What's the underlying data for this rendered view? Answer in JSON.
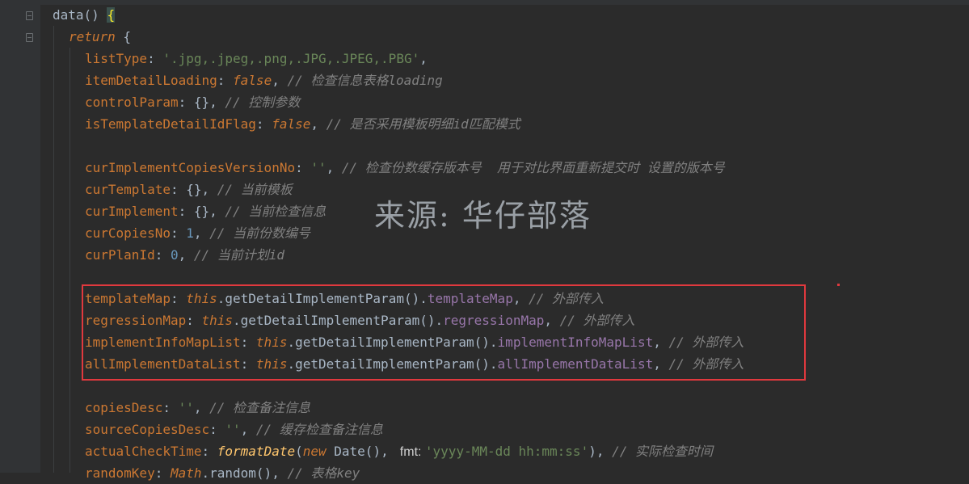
{
  "code_lines": [
    {
      "tokens": [
        {
          "t": "data",
          "c": "method"
        },
        {
          "t": "() ",
          "c": "punc"
        },
        {
          "t": "{",
          "c": "brace-hl"
        }
      ]
    },
    {
      "tokens": [
        {
          "t": "return",
          "c": "kwi"
        },
        {
          "t": " {",
          "c": "punc"
        }
      ]
    },
    {
      "tokens": [
        {
          "t": "listType",
          "c": "prop"
        },
        {
          "t": ": ",
          "c": "punc"
        },
        {
          "t": "'.jpg,.jpeg,.png,.JPG,.JPEG,.PBG'",
          "c": "str"
        },
        {
          "t": ",",
          "c": "punc"
        }
      ]
    },
    {
      "tokens": [
        {
          "t": "itemDetailLoading",
          "c": "prop"
        },
        {
          "t": ": ",
          "c": "punc"
        },
        {
          "t": "false",
          "c": "kwi"
        },
        {
          "t": ", ",
          "c": "punc"
        },
        {
          "t": "// 检查信息表格loading",
          "c": "cmt"
        }
      ]
    },
    {
      "tokens": [
        {
          "t": "controlParam",
          "c": "prop"
        },
        {
          "t": ": {}, ",
          "c": "punc"
        },
        {
          "t": "// 控制参数",
          "c": "cmt"
        }
      ]
    },
    {
      "tokens": [
        {
          "t": "isTemplateDetailIdFlag",
          "c": "prop"
        },
        {
          "t": ": ",
          "c": "punc"
        },
        {
          "t": "false",
          "c": "kwi"
        },
        {
          "t": ", ",
          "c": "punc"
        },
        {
          "t": "// 是否采用模板明细id匹配模式",
          "c": "cmt"
        }
      ]
    },
    {
      "tokens": []
    },
    {
      "tokens": [
        {
          "t": "curImplementCopiesVersionNo",
          "c": "prop"
        },
        {
          "t": ": ",
          "c": "punc"
        },
        {
          "t": "''",
          "c": "str"
        },
        {
          "t": ", ",
          "c": "punc"
        },
        {
          "t": "// 检查份数缓存版本号  用于对比界面重新提交时 设置的版本号",
          "c": "cmt"
        }
      ]
    },
    {
      "tokens": [
        {
          "t": "curTemplate",
          "c": "prop"
        },
        {
          "t": ": {}, ",
          "c": "punc"
        },
        {
          "t": "// 当前模板",
          "c": "cmt"
        }
      ]
    },
    {
      "tokens": [
        {
          "t": "curImplement",
          "c": "prop"
        },
        {
          "t": ": {}, ",
          "c": "punc"
        },
        {
          "t": "// 当前检查信息",
          "c": "cmt"
        }
      ]
    },
    {
      "tokens": [
        {
          "t": "curCopiesNo",
          "c": "prop"
        },
        {
          "t": ": ",
          "c": "punc"
        },
        {
          "t": "1",
          "c": "num"
        },
        {
          "t": ", ",
          "c": "punc"
        },
        {
          "t": "// 当前份数编号",
          "c": "cmt"
        }
      ]
    },
    {
      "tokens": [
        {
          "t": "curPlanId",
          "c": "prop"
        },
        {
          "t": ": ",
          "c": "punc"
        },
        {
          "t": "0",
          "c": "num"
        },
        {
          "t": ", ",
          "c": "punc"
        },
        {
          "t": "// 当前计划id",
          "c": "cmt"
        }
      ]
    },
    {
      "tokens": []
    },
    {
      "tokens": [
        {
          "t": "templateMap",
          "c": "prop"
        },
        {
          "t": ": ",
          "c": "punc"
        },
        {
          "t": "this",
          "c": "this"
        },
        {
          "t": ".getDetailImplementParam().",
          "c": "method"
        },
        {
          "t": "templateMap",
          "c": "field"
        },
        {
          "t": ", ",
          "c": "punc"
        },
        {
          "t": "// 外部传入",
          "c": "cmt"
        }
      ]
    },
    {
      "tokens": [
        {
          "t": "regressionMap",
          "c": "prop"
        },
        {
          "t": ": ",
          "c": "punc"
        },
        {
          "t": "this",
          "c": "this"
        },
        {
          "t": ".getDetailImplementParam().",
          "c": "method"
        },
        {
          "t": "regressionMap",
          "c": "field"
        },
        {
          "t": ", ",
          "c": "punc"
        },
        {
          "t": "// 外部传入",
          "c": "cmt"
        }
      ]
    },
    {
      "tokens": [
        {
          "t": "implementInfoMapList",
          "c": "prop"
        },
        {
          "t": ": ",
          "c": "punc"
        },
        {
          "t": "this",
          "c": "this"
        },
        {
          "t": ".getDetailImplementParam().",
          "c": "method"
        },
        {
          "t": "implementInfoMapList",
          "c": "field"
        },
        {
          "t": ", ",
          "c": "punc"
        },
        {
          "t": "// 外部传入",
          "c": "cmt"
        }
      ]
    },
    {
      "tokens": [
        {
          "t": "allImplementDataList",
          "c": "prop"
        },
        {
          "t": ": ",
          "c": "punc"
        },
        {
          "t": "this",
          "c": "this"
        },
        {
          "t": ".getDetailImplementParam().",
          "c": "method"
        },
        {
          "t": "allImplementDataList",
          "c": "field"
        },
        {
          "t": ", ",
          "c": "punc"
        },
        {
          "t": "// 外部传入",
          "c": "cmt"
        }
      ]
    },
    {
      "tokens": []
    },
    {
      "tokens": [
        {
          "t": "copiesDesc",
          "c": "prop"
        },
        {
          "t": ": ",
          "c": "punc"
        },
        {
          "t": "''",
          "c": "str"
        },
        {
          "t": ", ",
          "c": "punc"
        },
        {
          "t": "// 检查备注信息",
          "c": "cmt"
        }
      ]
    },
    {
      "tokens": [
        {
          "t": "sourceCopiesDesc",
          "c": "prop"
        },
        {
          "t": ": ",
          "c": "punc"
        },
        {
          "t": "''",
          "c": "str"
        },
        {
          "t": ", ",
          "c": "punc"
        },
        {
          "t": "// 缓存检查备注信息",
          "c": "cmt"
        }
      ]
    },
    {
      "tokens": [
        {
          "t": "actualCheckTime",
          "c": "prop"
        },
        {
          "t": ": ",
          "c": "punc"
        },
        {
          "t": "formatDate",
          "c": "fn-it"
        },
        {
          "t": "(",
          "c": "punc"
        },
        {
          "t": "new",
          "c": "kwi"
        },
        {
          "t": " Date(), ",
          "c": "punc"
        },
        {
          "t": " fmt: ",
          "c": "hint"
        },
        {
          "t": "'yyyy-MM-dd hh:mm:ss'",
          "c": "str"
        },
        {
          "t": "), ",
          "c": "punc"
        },
        {
          "t": "// 实际检查时间",
          "c": "cmt"
        }
      ]
    },
    {
      "tokens": [
        {
          "t": "randomKey",
          "c": "prop"
        },
        {
          "t": ": ",
          "c": "punc"
        },
        {
          "t": "Math",
          "c": "kwi"
        },
        {
          "t": ".random(), ",
          "c": "punc"
        },
        {
          "t": "// 表格key",
          "c": "cmt"
        }
      ]
    }
  ],
  "watermark": "来源: 华仔部落"
}
